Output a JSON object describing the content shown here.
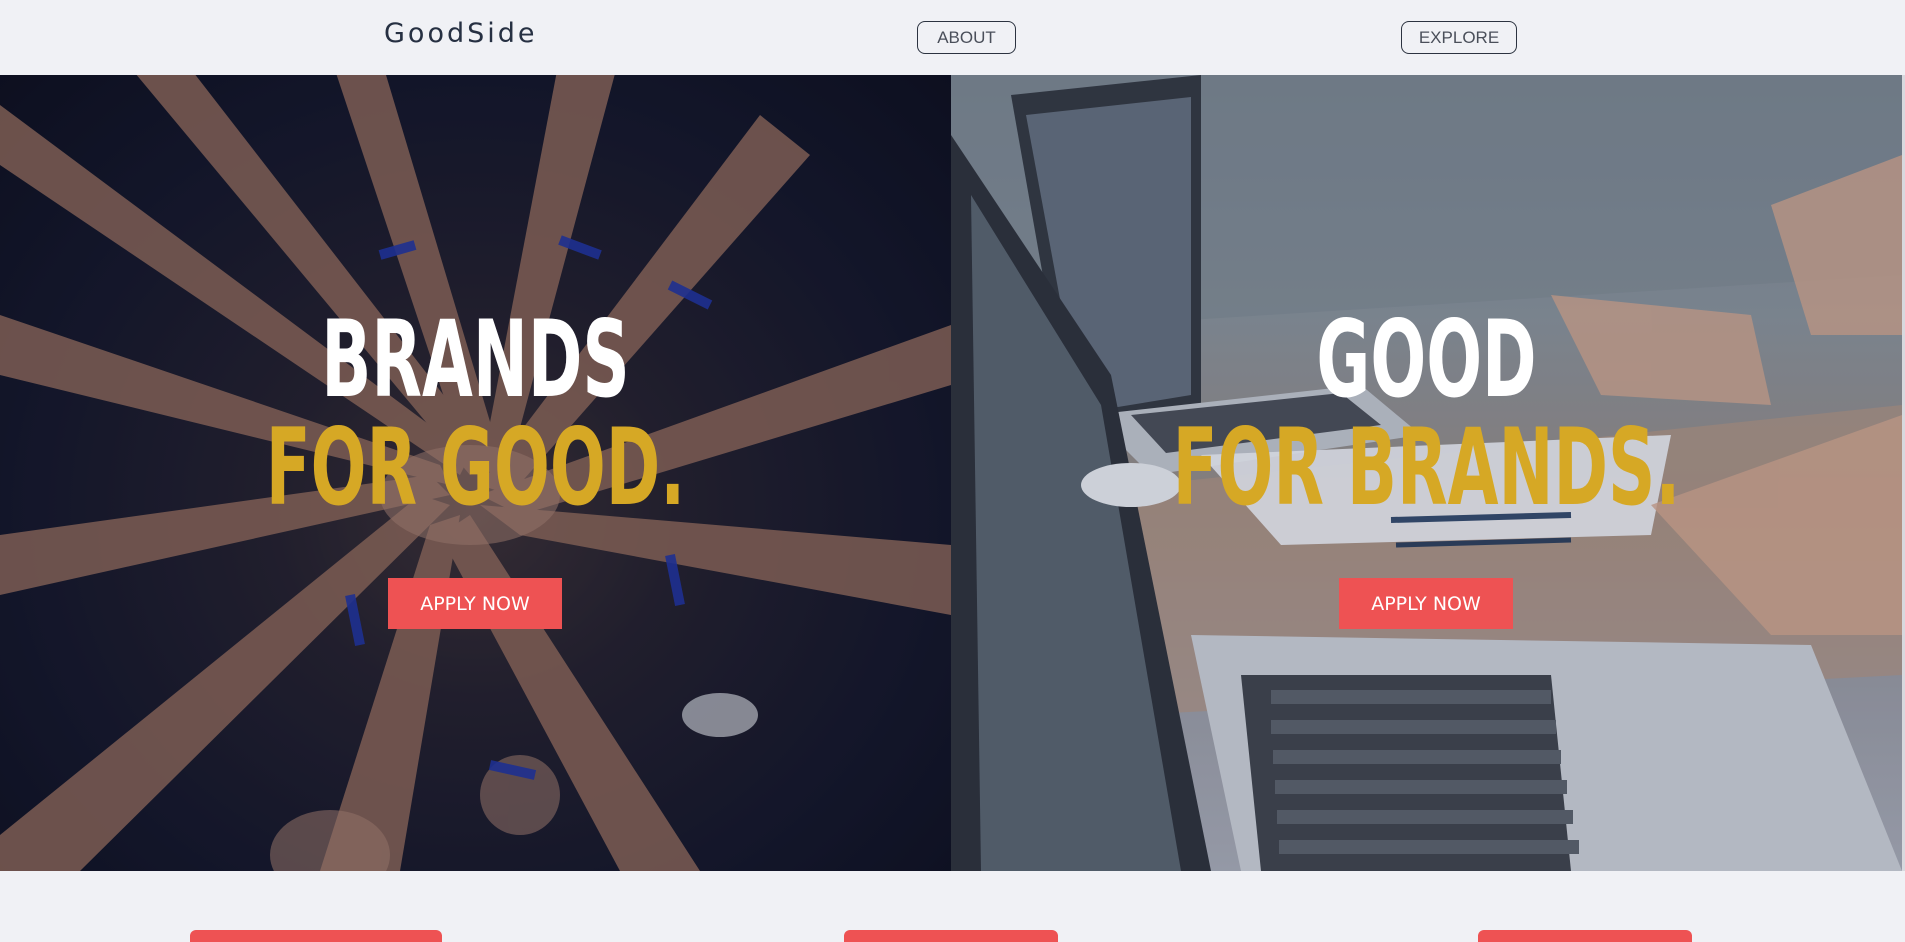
{
  "navbar": {
    "brand": "GoodSide",
    "about_label": "ABOUT",
    "explore_label": "EXPLORE"
  },
  "hero_left": {
    "headline_white": "BRANDS",
    "headline_gold": "FOR GOOD.",
    "button_label": "APPLY NOW"
  },
  "hero_right": {
    "headline_white": "GOOD",
    "headline_gold": "FOR BRANDS.",
    "button_label": "APPLY NOW"
  },
  "colors": {
    "accent": "#ee5253",
    "gold": "#d6a825",
    "background": "#f0f1f5",
    "text_dark": "#263042"
  }
}
